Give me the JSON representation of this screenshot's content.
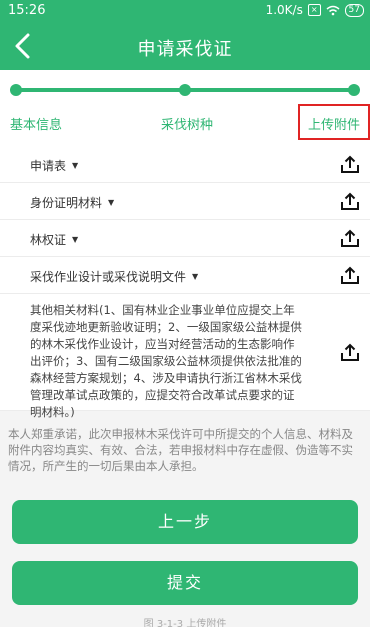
{
  "status": {
    "time": "15:26",
    "speed": "1.0K/s",
    "battery": "57"
  },
  "header": {
    "title": "申请采伐证"
  },
  "steps": [
    "基本信息",
    "采伐树种",
    "上传附件"
  ],
  "files": [
    {
      "label": "申请表"
    },
    {
      "label": "身份证明材料"
    },
    {
      "label": "林权证"
    },
    {
      "label": "采伐作业设计或采伐说明文件"
    }
  ],
  "other": {
    "label": "其他相关材料(1、国有林业企业事业单位应提交上年度采伐迹地更新验收证明；2、一级国家级公益林提供的林木采伐作业设计，应当对经营活动的生态影响作出评价；3、国有二级国家级公益林须提供依法批准的森林经营方案规划；4、涉及申请执行浙江省林木采伐管理改革试点政策的，应提交符合改革试点要求的证明材料。)"
  },
  "notice": "本人郑重承诺，此次申报林木采伐许可中所提交的个人信息、材料及附件内容均真实、有效、合法，若申报材料中存在虚假、伪造等不实情况，所产生的一切后果由本人承担。",
  "buttons": {
    "prev": "上一步",
    "submit": "提交"
  },
  "bottom": "图 3-1-3  上传附件"
}
